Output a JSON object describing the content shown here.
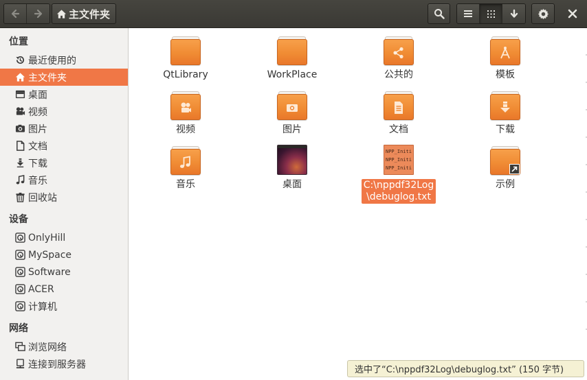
{
  "window": {
    "path_label": "主文件夹",
    "icons": {
      "back": "back-arrow-icon",
      "forward": "forward-arrow-icon",
      "home": "home-icon",
      "search": "search-icon",
      "list": "list-view-icon",
      "grid": "grid-view-icon",
      "sort": "down-arrow-icon",
      "settings": "gear-icon",
      "close": "close-icon"
    }
  },
  "sidebar": {
    "places_heading": "位置",
    "places": [
      {
        "label": "最近使用的",
        "icon": "recent-icon"
      },
      {
        "label": "主文件夹",
        "icon": "home-icon",
        "selected": true
      },
      {
        "label": "桌面",
        "icon": "desktop-icon"
      },
      {
        "label": "视频",
        "icon": "video-icon"
      },
      {
        "label": "图片",
        "icon": "camera-icon"
      },
      {
        "label": "文档",
        "icon": "document-icon"
      },
      {
        "label": "下载",
        "icon": "download-icon"
      },
      {
        "label": "音乐",
        "icon": "music-icon"
      },
      {
        "label": "回收站",
        "icon": "trash-icon"
      }
    ],
    "devices_heading": "设备",
    "devices": [
      {
        "label": "OnlyHill",
        "icon": "drive-icon"
      },
      {
        "label": "MySpace",
        "icon": "drive-icon"
      },
      {
        "label": "Software",
        "icon": "drive-icon"
      },
      {
        "label": "ACER",
        "icon": "drive-icon"
      },
      {
        "label": "计算机",
        "icon": "computer-icon"
      }
    ],
    "network_heading": "网络",
    "network": [
      {
        "label": "浏览网络",
        "icon": "network-icon"
      },
      {
        "label": "连接到服务器",
        "icon": "server-icon"
      }
    ]
  },
  "files": [
    {
      "name": "QtLibrary",
      "kind": "folder"
    },
    {
      "name": "WorkPlace",
      "kind": "folder"
    },
    {
      "name": "公共的",
      "kind": "folder",
      "emblem": "share-icon"
    },
    {
      "name": "模板",
      "kind": "folder",
      "emblem": "compass-icon"
    },
    {
      "name": "视频",
      "kind": "folder",
      "emblem": "camera-reel-icon"
    },
    {
      "name": "图片",
      "kind": "folder",
      "emblem": "photo-icon"
    },
    {
      "name": "文档",
      "kind": "folder",
      "emblem": "document-icon"
    },
    {
      "name": "下载",
      "kind": "folder",
      "emblem": "download-icon"
    },
    {
      "name": "音乐",
      "kind": "folder",
      "emblem": "music-icon"
    },
    {
      "name": "桌面",
      "kind": "desktop"
    },
    {
      "name": "C:\\nppdf32Log\\debuglog.txt",
      "name_line1": "C:\\nppdf32Log",
      "name_line2": "\\debuglog.txt",
      "kind": "text",
      "selected": true,
      "preview_lines": [
        "NPP_Initia",
        "NPP_Initia",
        "NPP_Initia"
      ]
    },
    {
      "name": "示例",
      "kind": "folder-link",
      "emblem": "link-arrow-icon"
    }
  ],
  "status": {
    "text": "选中了“C:\\nppdf32Log\\debuglog.txt” (150 字节)"
  },
  "colors": {
    "accent": "#f07746",
    "headerbar": "#3c3b37",
    "folder": "#f08c34",
    "status_bg": "#f5f1d4"
  }
}
